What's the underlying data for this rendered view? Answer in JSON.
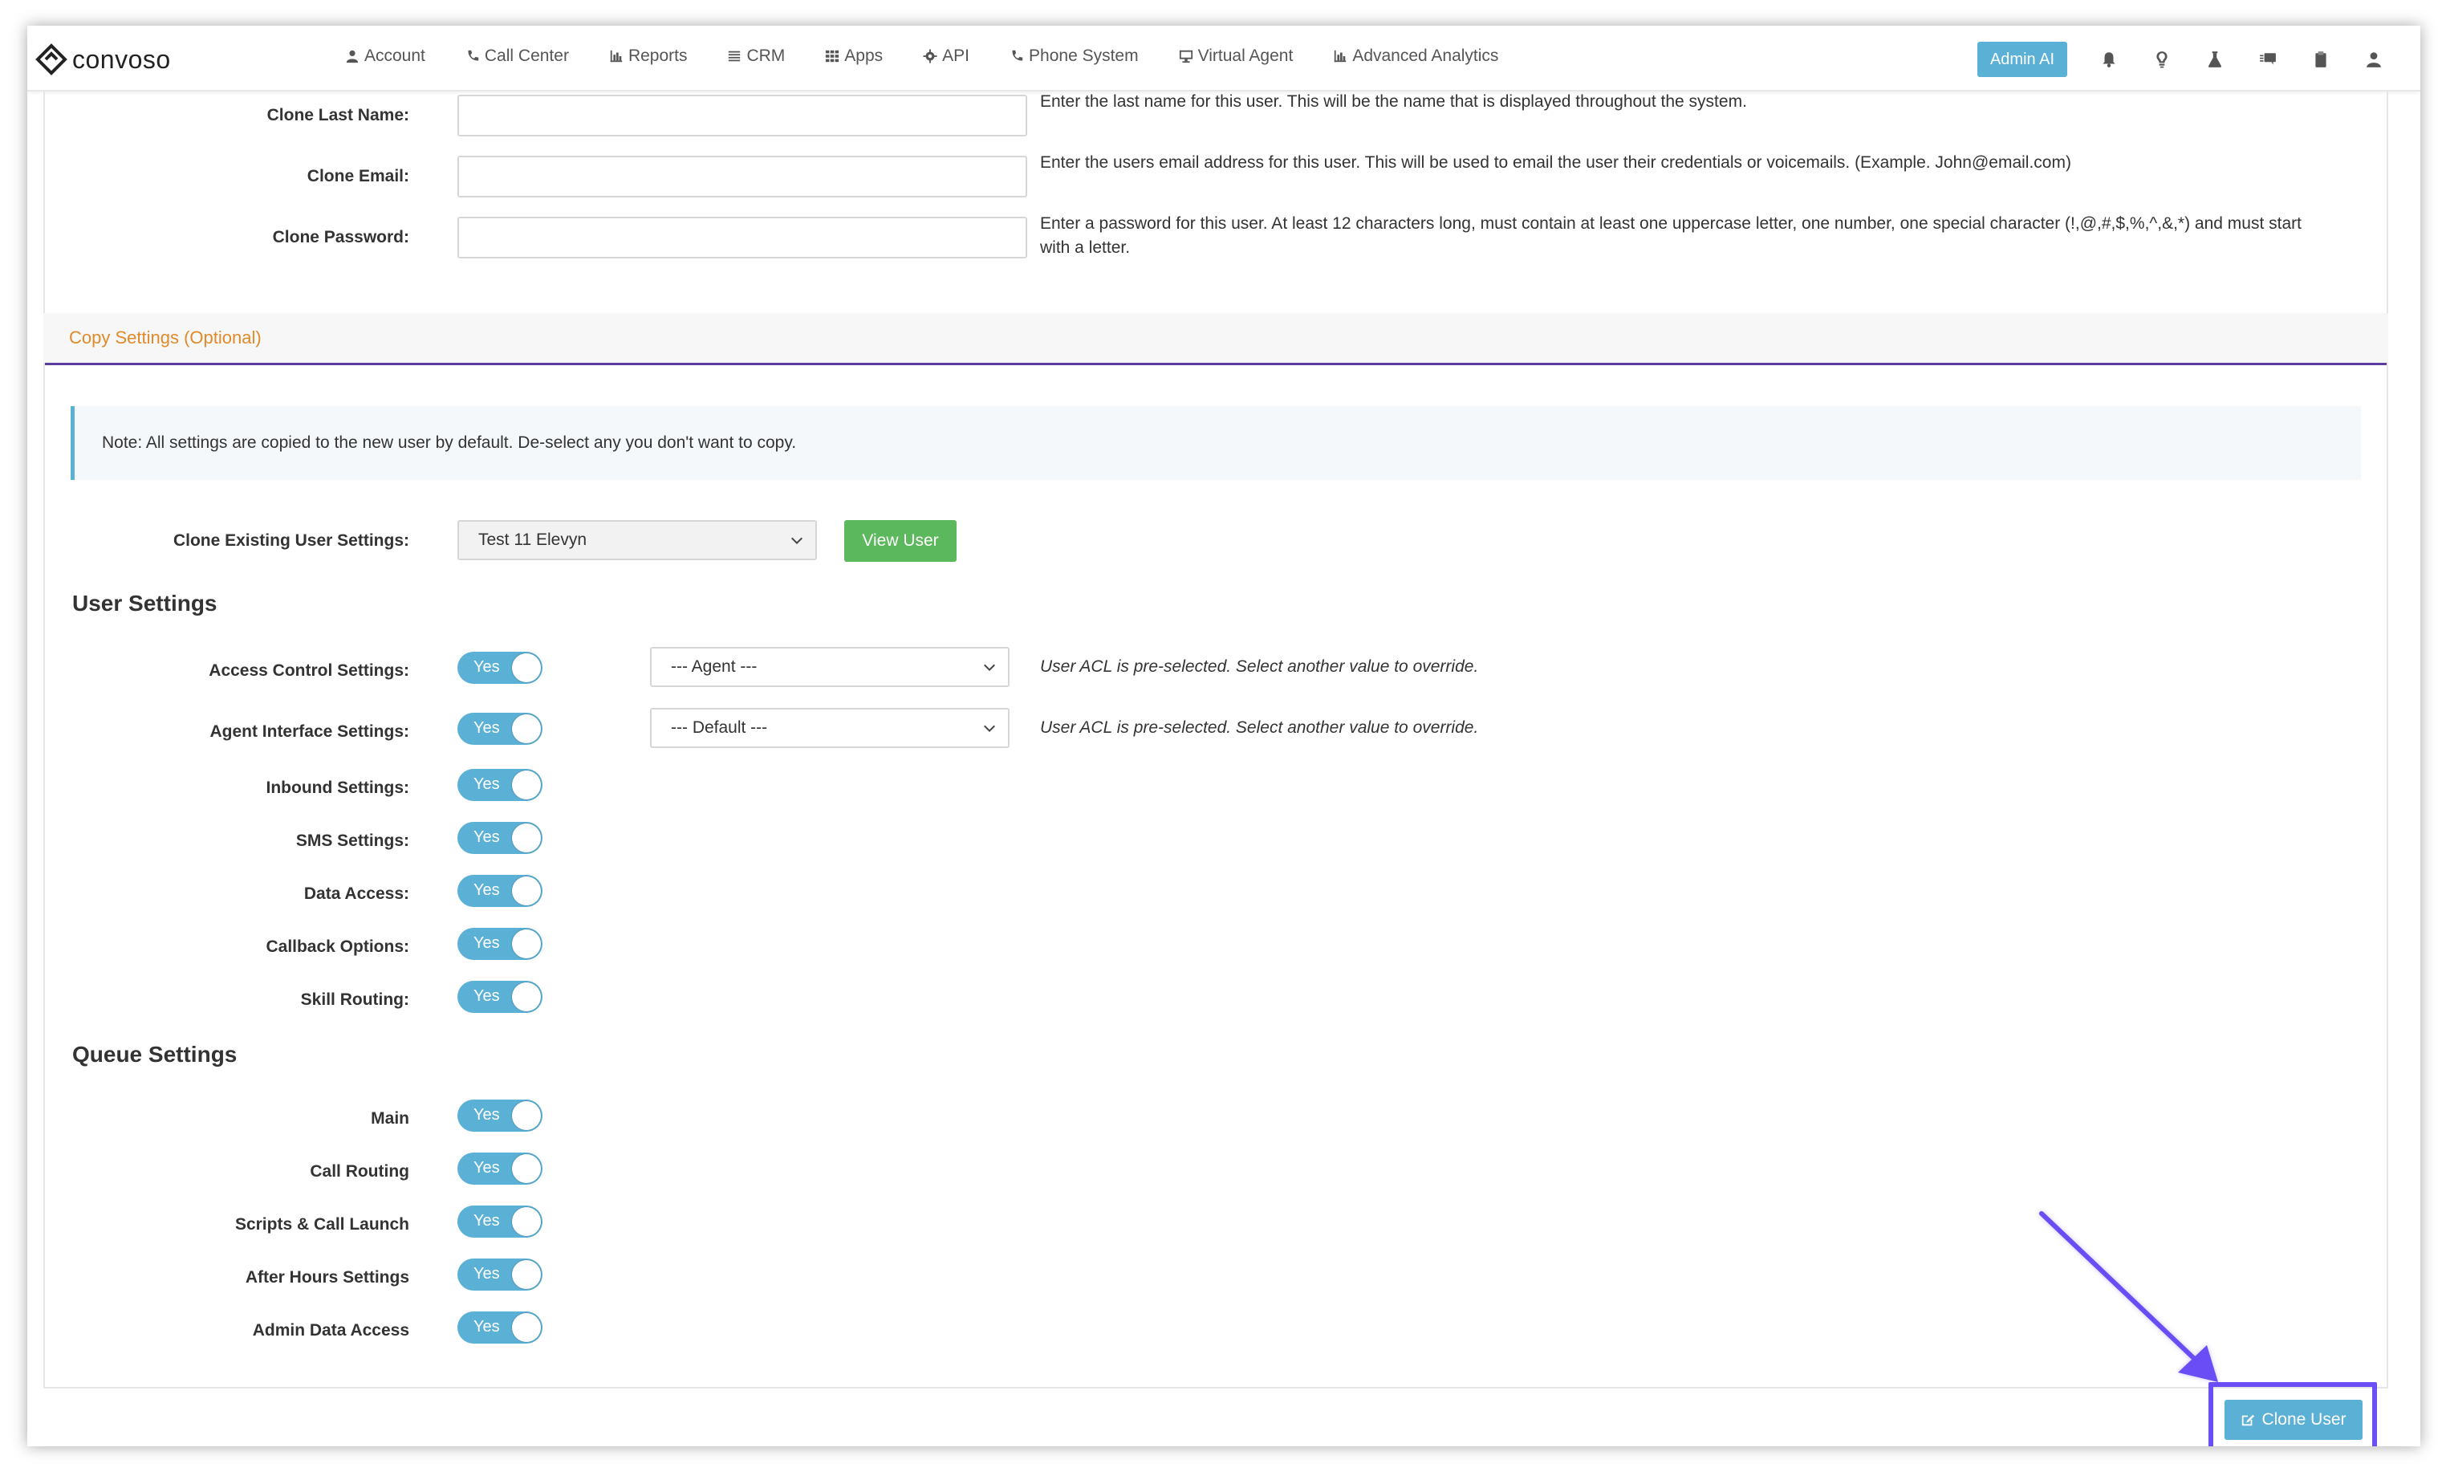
{
  "brand": {
    "name": "convoso"
  },
  "nav": {
    "items": [
      {
        "label": "Account",
        "icon": "user-icon"
      },
      {
        "label": "Call Center",
        "icon": "phone-icon"
      },
      {
        "label": "Reports",
        "icon": "bar-chart-icon"
      },
      {
        "label": "CRM",
        "icon": "list-icon"
      },
      {
        "label": "Apps",
        "icon": "grid-icon"
      },
      {
        "label": "API",
        "icon": "gear-icon"
      },
      {
        "label": "Phone System",
        "icon": "phone-icon"
      },
      {
        "label": "Virtual Agent",
        "icon": "monitor-icon"
      },
      {
        "label": "Advanced Analytics",
        "icon": "bar-chart-icon"
      }
    ],
    "admin_ai": "Admin AI",
    "top_icons": [
      "bell-icon",
      "lightbulb-icon",
      "flask-icon",
      "chat-icon",
      "clipboard-icon",
      "user-icon"
    ]
  },
  "clone_fields": {
    "last_name": {
      "label": "Clone Last Name:",
      "value": "",
      "help": "Enter the last name for this user. This will be the name that is displayed throughout the system."
    },
    "email": {
      "label": "Clone Email:",
      "value": "",
      "help": "Enter the users email address for this user. This will be used to email the user their credentials or voicemails. (Example. John@email.com)"
    },
    "password": {
      "label": "Clone Password:",
      "value": "",
      "help_line1": "Enter a password for this user. At least 12 characters long, must contain at least one uppercase letter, one number, one special character (!,@,#,$,%,^,&,*) and must start",
      "help_line2": "with a letter."
    }
  },
  "copy_settings": {
    "section_title": "Copy Settings (Optional)",
    "note": "Note: All settings are copied to the new user by default. De-select any you don't want to copy.",
    "clone_existing_label": "Clone Existing User Settings:",
    "clone_existing_value": "Test 11 Elevyn",
    "view_user": "View User"
  },
  "user_settings": {
    "heading": "User Settings",
    "acl_help": "User ACL is pre-selected. Select another value to override.",
    "rows": [
      {
        "label": "Access Control Settings:",
        "toggle": "Yes",
        "select": "--- Agent ---"
      },
      {
        "label": "Agent Interface Settings:",
        "toggle": "Yes",
        "select": "--- Default ---"
      },
      {
        "label": "Inbound Settings:",
        "toggle": "Yes"
      },
      {
        "label": "SMS Settings:",
        "toggle": "Yes"
      },
      {
        "label": "Data Access:",
        "toggle": "Yes"
      },
      {
        "label": "Callback Options:",
        "toggle": "Yes"
      },
      {
        "label": "Skill Routing:",
        "toggle": "Yes"
      }
    ]
  },
  "queue_settings": {
    "heading": "Queue Settings",
    "rows": [
      {
        "label": "Main",
        "toggle": "Yes"
      },
      {
        "label": "Call Routing",
        "toggle": "Yes"
      },
      {
        "label": "Scripts & Call Launch",
        "toggle": "Yes"
      },
      {
        "label": "After Hours Settings",
        "toggle": "Yes"
      },
      {
        "label": "Admin Data Access",
        "toggle": "Yes"
      }
    ]
  },
  "footer": {
    "clone_user": "Clone User"
  },
  "colors": {
    "accent": "#5bb0d6",
    "green": "#5cb85c",
    "section_orange": "#e08a2a",
    "divider_purple": "#5b3ea0",
    "highlight": "#6b4ef5"
  }
}
